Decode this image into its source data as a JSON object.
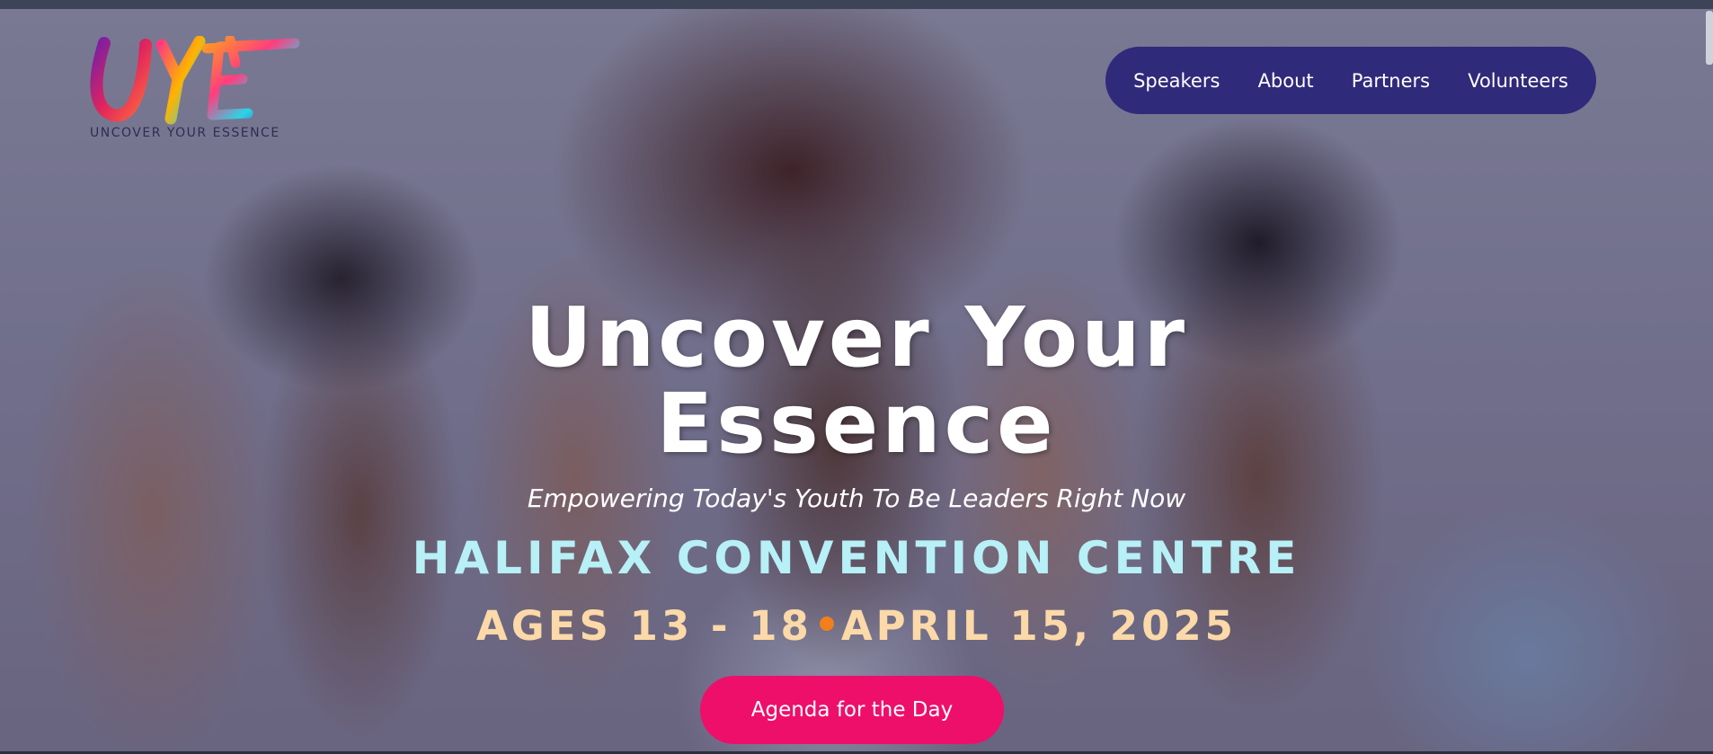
{
  "logo": {
    "letters": "UYE",
    "tagline": "UNCOVER YOUR ESSENCE"
  },
  "nav": {
    "items": [
      "Speakers",
      "About",
      "Partners",
      "Volunteers"
    ]
  },
  "hero": {
    "title_line1": "Uncover Your",
    "title_line2": "Essence",
    "subtitle": "Empowering Today's Youth To Be Leaders Right Now",
    "venue": "HALIFAX CONVENTION CENTRE",
    "ages": "AGES 13 - 18",
    "date": "APRIL 15, 2025",
    "cta_label": "Agenda for the Day"
  },
  "colors": {
    "nav_bg": "#302a7a",
    "venue_text": "#b7f0f6",
    "date_text": "#fbd9a8",
    "dot": "#f07f1c",
    "cta_bg": "#ee0f6b"
  }
}
